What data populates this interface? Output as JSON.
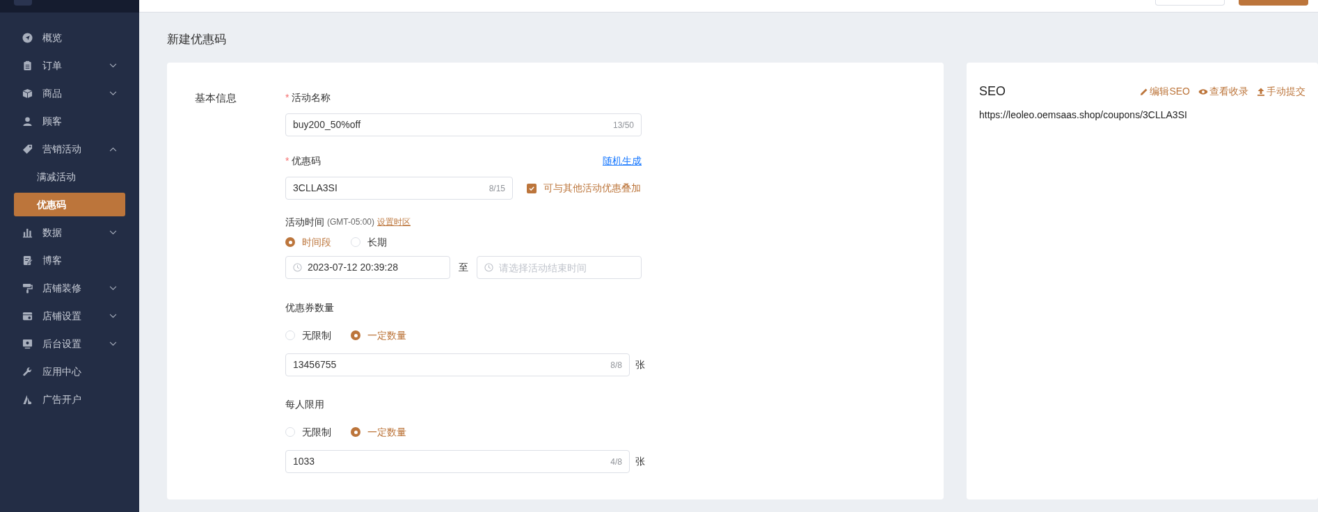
{
  "sidebar": {
    "items": [
      {
        "kind": "link",
        "label": "概览",
        "selected": false
      },
      {
        "kind": "group",
        "label": "订单",
        "expanded": false
      },
      {
        "kind": "group",
        "label": "商品",
        "expanded": false
      },
      {
        "kind": "link",
        "label": "顾客",
        "selected": false
      },
      {
        "kind": "group",
        "label": "营销活动",
        "expanded": true,
        "children": [
          {
            "label": "满减活动",
            "selected": false
          },
          {
            "label": "优惠码",
            "selected": true
          }
        ]
      },
      {
        "kind": "group",
        "label": "数据",
        "expanded": false
      },
      {
        "kind": "link",
        "label": "博客",
        "selected": false
      },
      {
        "kind": "group",
        "label": "店铺装修",
        "expanded": false
      },
      {
        "kind": "group",
        "label": "店铺设置",
        "expanded": false
      },
      {
        "kind": "group",
        "label": "后台设置",
        "expanded": false
      },
      {
        "kind": "link",
        "label": "应用中心",
        "selected": false
      },
      {
        "kind": "link",
        "label": "广告开户",
        "selected": false
      }
    ]
  },
  "page_title": "新建优惠码",
  "form": {
    "section_title": "基本信息",
    "name_field": {
      "label": "活动名称",
      "required_mark": "*",
      "value": "buy200_50%off",
      "counter": "13/50"
    },
    "code_field": {
      "label": "优惠码",
      "required_mark": "*",
      "action": "随机生成",
      "value": "3CLLA3SI",
      "counter": "8/15",
      "stack_checkbox": {
        "label": "可与其他活动优惠叠加",
        "checked": true
      }
    },
    "time": {
      "label": "活动时间",
      "timezone": "(GMT-05:00)",
      "timezone_link": "设置时区",
      "options": [
        {
          "label": "时间段",
          "selected": true
        },
        {
          "label": "长期",
          "selected": false
        }
      ],
      "start": {
        "value": "2023-07-12 20:39:28"
      },
      "separator": "至",
      "end": {
        "placeholder": "请选择活动结束时间"
      }
    },
    "quantity": {
      "label": "优惠券数量",
      "options": [
        {
          "label": "无限制",
          "selected": false
        },
        {
          "label": "一定数量",
          "selected": true
        }
      ],
      "value": "13456755",
      "counter": "8/8",
      "unit": "张"
    },
    "per_user": {
      "label": "每人限用",
      "options": [
        {
          "label": "无限制",
          "selected": false
        },
        {
          "label": "一定数量",
          "selected": true
        }
      ],
      "value": "1033",
      "counter": "4/8",
      "unit": "张"
    }
  },
  "seo": {
    "title": "SEO",
    "actions": [
      "编辑SEO",
      "查看收录",
      "手动提交"
    ],
    "url": "https://leoleo.oemsaas.shop/coupons/3CLLA3SI"
  }
}
